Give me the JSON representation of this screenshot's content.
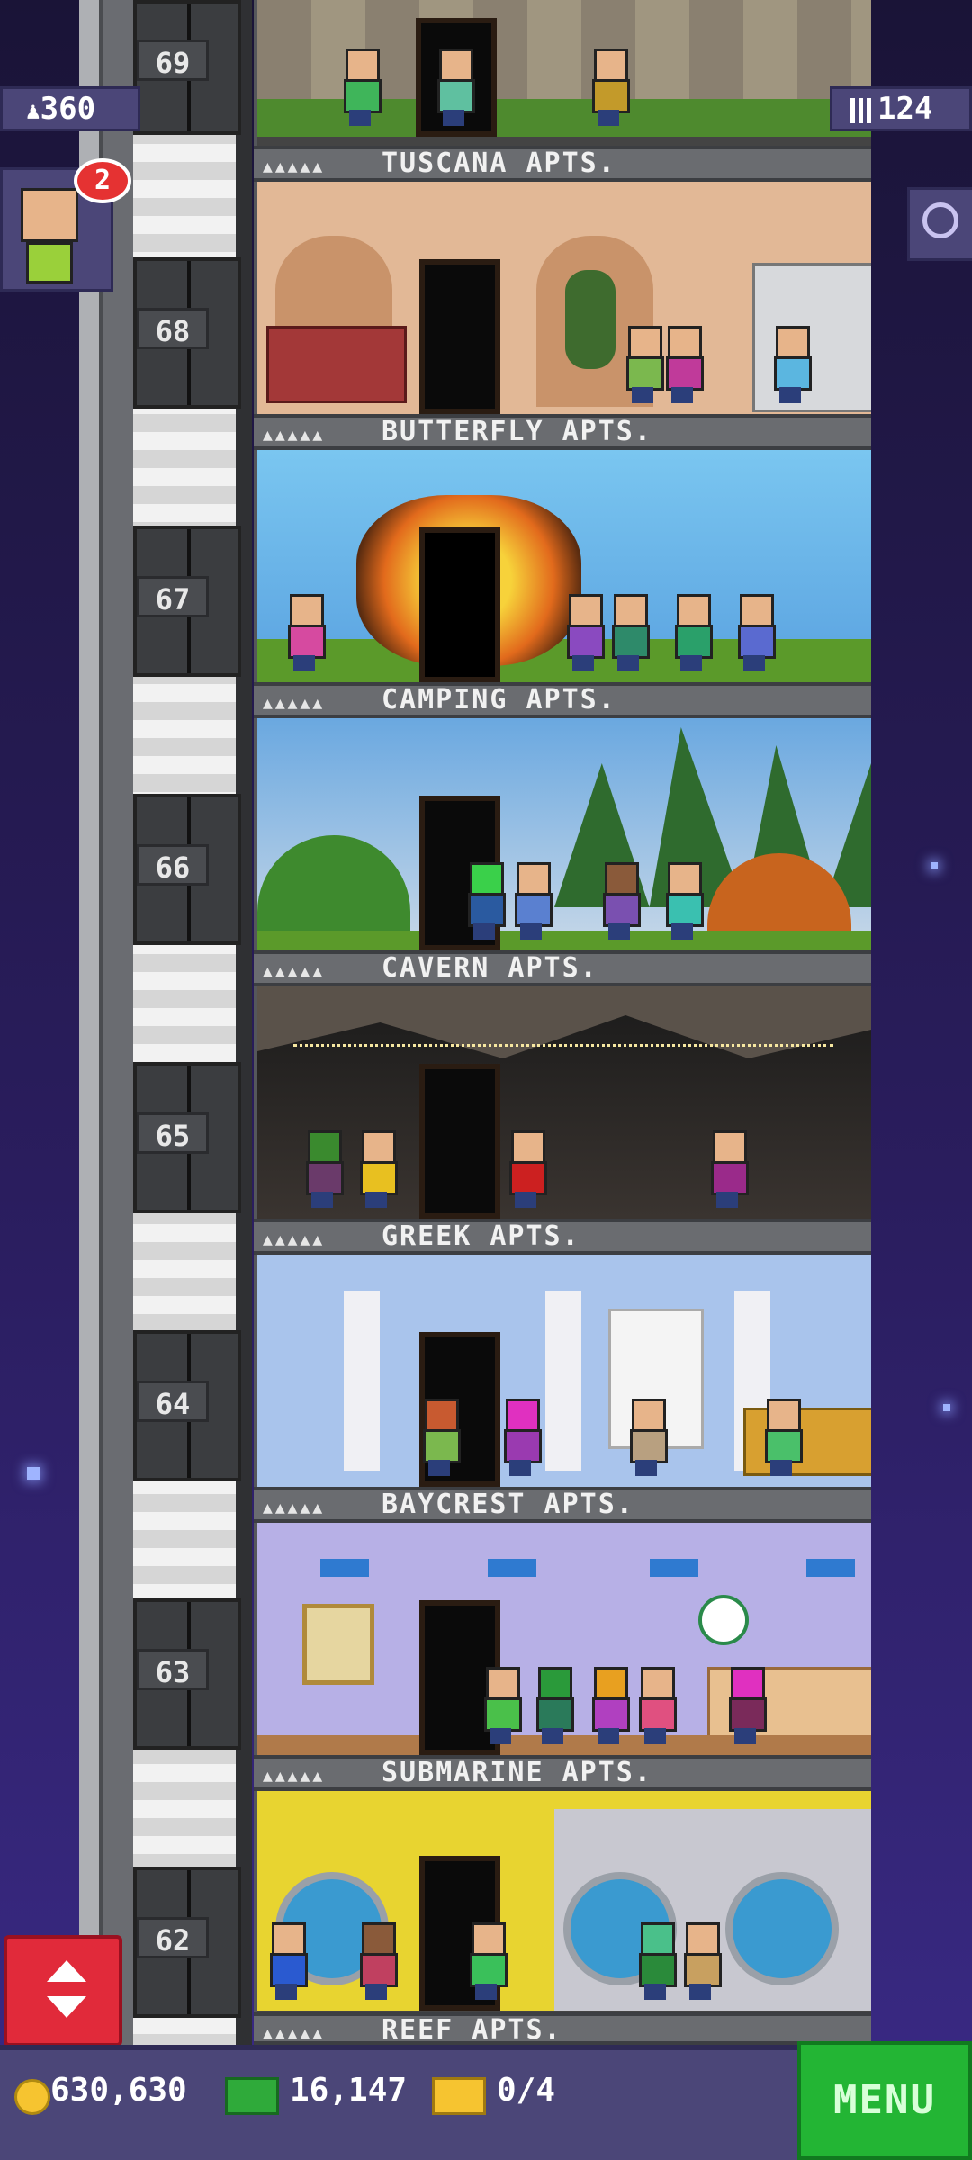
{
  "hud": {
    "population": "360",
    "units": "124",
    "visitor_badge": "2"
  },
  "floors": [
    {
      "number": "69",
      "name": "TUSCANA APTS."
    },
    {
      "number": "68",
      "name": "BUTTERFLY APTS."
    },
    {
      "number": "67",
      "name": "CAMPING APTS."
    },
    {
      "number": "66",
      "name": "CAVERN APTS."
    },
    {
      "number": "65",
      "name": "GREEK APTS."
    },
    {
      "number": "64",
      "name": "BAYCREST APTS."
    },
    {
      "number": "63",
      "name": "SUBMARINE APTS."
    },
    {
      "number": "62",
      "name": "REEF APTS."
    }
  ],
  "resources": {
    "coins": "630,630",
    "bux": "16,147",
    "tickets": "0/4"
  },
  "menu_label": "MENU",
  "colors": {
    "menu_green": "#23b534",
    "elevator_red": "#e12a3a",
    "hud_purple": "#4b4678"
  },
  "icons": [
    "person-icon",
    "building-icon",
    "magnifier-icon",
    "up-down-arrows-icon",
    "coin-icon",
    "bux-icon",
    "ticket-icon"
  ]
}
